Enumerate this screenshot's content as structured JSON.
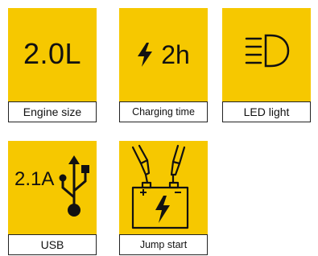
{
  "theme": {
    "yellow": "#f6c800",
    "ink": "#111111"
  },
  "features": {
    "engine": {
      "value": "2.0L",
      "label": "Engine size"
    },
    "charging": {
      "value": "2h",
      "label": "Charging time",
      "icon": "lightning-bolt-icon"
    },
    "led": {
      "label": "LED light",
      "icon": "headlight-icon"
    },
    "usb": {
      "value": "2.1A",
      "label": "USB",
      "icon": "usb-icon"
    },
    "jump": {
      "label": "Jump start",
      "icon": "battery-clamps-icon"
    }
  }
}
